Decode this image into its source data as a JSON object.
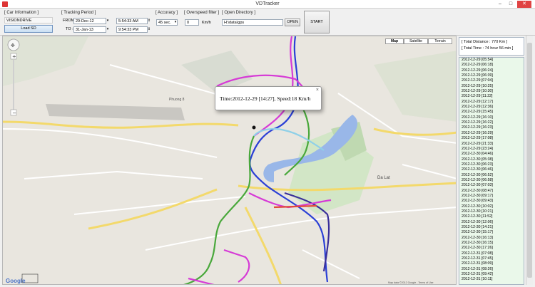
{
  "window": {
    "title": "VDTracker",
    "minimize": "–",
    "maximize": "□",
    "close": "✕"
  },
  "car_info": {
    "title": "[ Car Information ]",
    "vehicle": "VISIONDRIVE",
    "load_button": "Load SD"
  },
  "tracking_period": {
    "title": "[ Tracking Period ]",
    "from_label": "FROM :",
    "from_date": "29-Dec-12",
    "from_time": "5:54:33 AM",
    "to_label": "TO :",
    "to_date": "31-Jan-13",
    "to_time": "9:54:33 PM"
  },
  "accuracy": {
    "title": "[ Accuracy ]",
    "value": "45 sec."
  },
  "overspeed": {
    "title": "[ Overspeed filter ]",
    "value": "0",
    "unit": "Km/h"
  },
  "directory": {
    "title": "[ Open Directory ]",
    "path": "H:\\data\\gps",
    "open_button": "OPEN"
  },
  "start_button": "START",
  "map": {
    "type_buttons": [
      "Map",
      "Satellite",
      "Terrain"
    ],
    "info_text": "Time:2012-12-29 [14:27], Speed:18 Km/h",
    "close_glyph": "×",
    "google_logo": "Google",
    "attribution": "Map data ©2012 Google - Terms of Use",
    "place_labels": [
      "Da Lat",
      "Phuong 8"
    ]
  },
  "summary": {
    "distance": "[ Total Distance : 770 Km ]",
    "time": "[ Total Time : 74 hour 56 min ]"
  },
  "log_entries": [
    "2012-12-29 [05:54]",
    "2012-12-29 [06:18]",
    "2012-12-29 [06:24]",
    "2012-12-29 [06:39]",
    "2012-12-29 [07:04]",
    "2012-12-29 [10:25]",
    "2012-12-29 [10:30]",
    "2012-12-29 [11:22]",
    "2012-12-29 [12:17]",
    "2012-12-29 [12:36]",
    "2012-12-29 [15:45]",
    "2012-12-29 [16:10]",
    "2012-12-29 [16:22]",
    "2012-12-29 [16:23]",
    "2012-12-29 [16:29]",
    "2012-12-29 [17:08]",
    "2012-12-29 [21:33]",
    "2012-12-29 [23:24]",
    "2012-12-30 [04:46]",
    "2012-12-30 [05:38]",
    "2012-12-30 [06:23]",
    "2012-12-30 [06:46]",
    "2012-12-30 [06:52]",
    "2012-12-30 [06:58]",
    "2012-12-30 [07:03]",
    "2012-12-30 [08:47]",
    "2012-12-30 [09:17]",
    "2012-12-30 [09:43]",
    "2012-12-30 [10:02]",
    "2012-12-30 [10:21]",
    "2012-12-30 [11:52]",
    "2012-12-30 [12:06]",
    "2012-12-30 [14:21]",
    "2012-12-30 [15:17]",
    "2012-12-30 [16:13]",
    "2012-12-30 [16:15]",
    "2012-12-30 [17:26]",
    "2012-12-31 [07:08]",
    "2012-12-31 [07:45]",
    "2012-12-31 [08:09]",
    "2012-12-31 [08:26]",
    "2012-12-31 [09:42]",
    "2012-12-31 [10:11]"
  ],
  "colors": {
    "route_magenta": "#d63bd6",
    "route_blue": "#2a3fd6",
    "route_green": "#49a83b",
    "route_red": "#e04a3a",
    "list_bg": "#eaf8ea"
  }
}
